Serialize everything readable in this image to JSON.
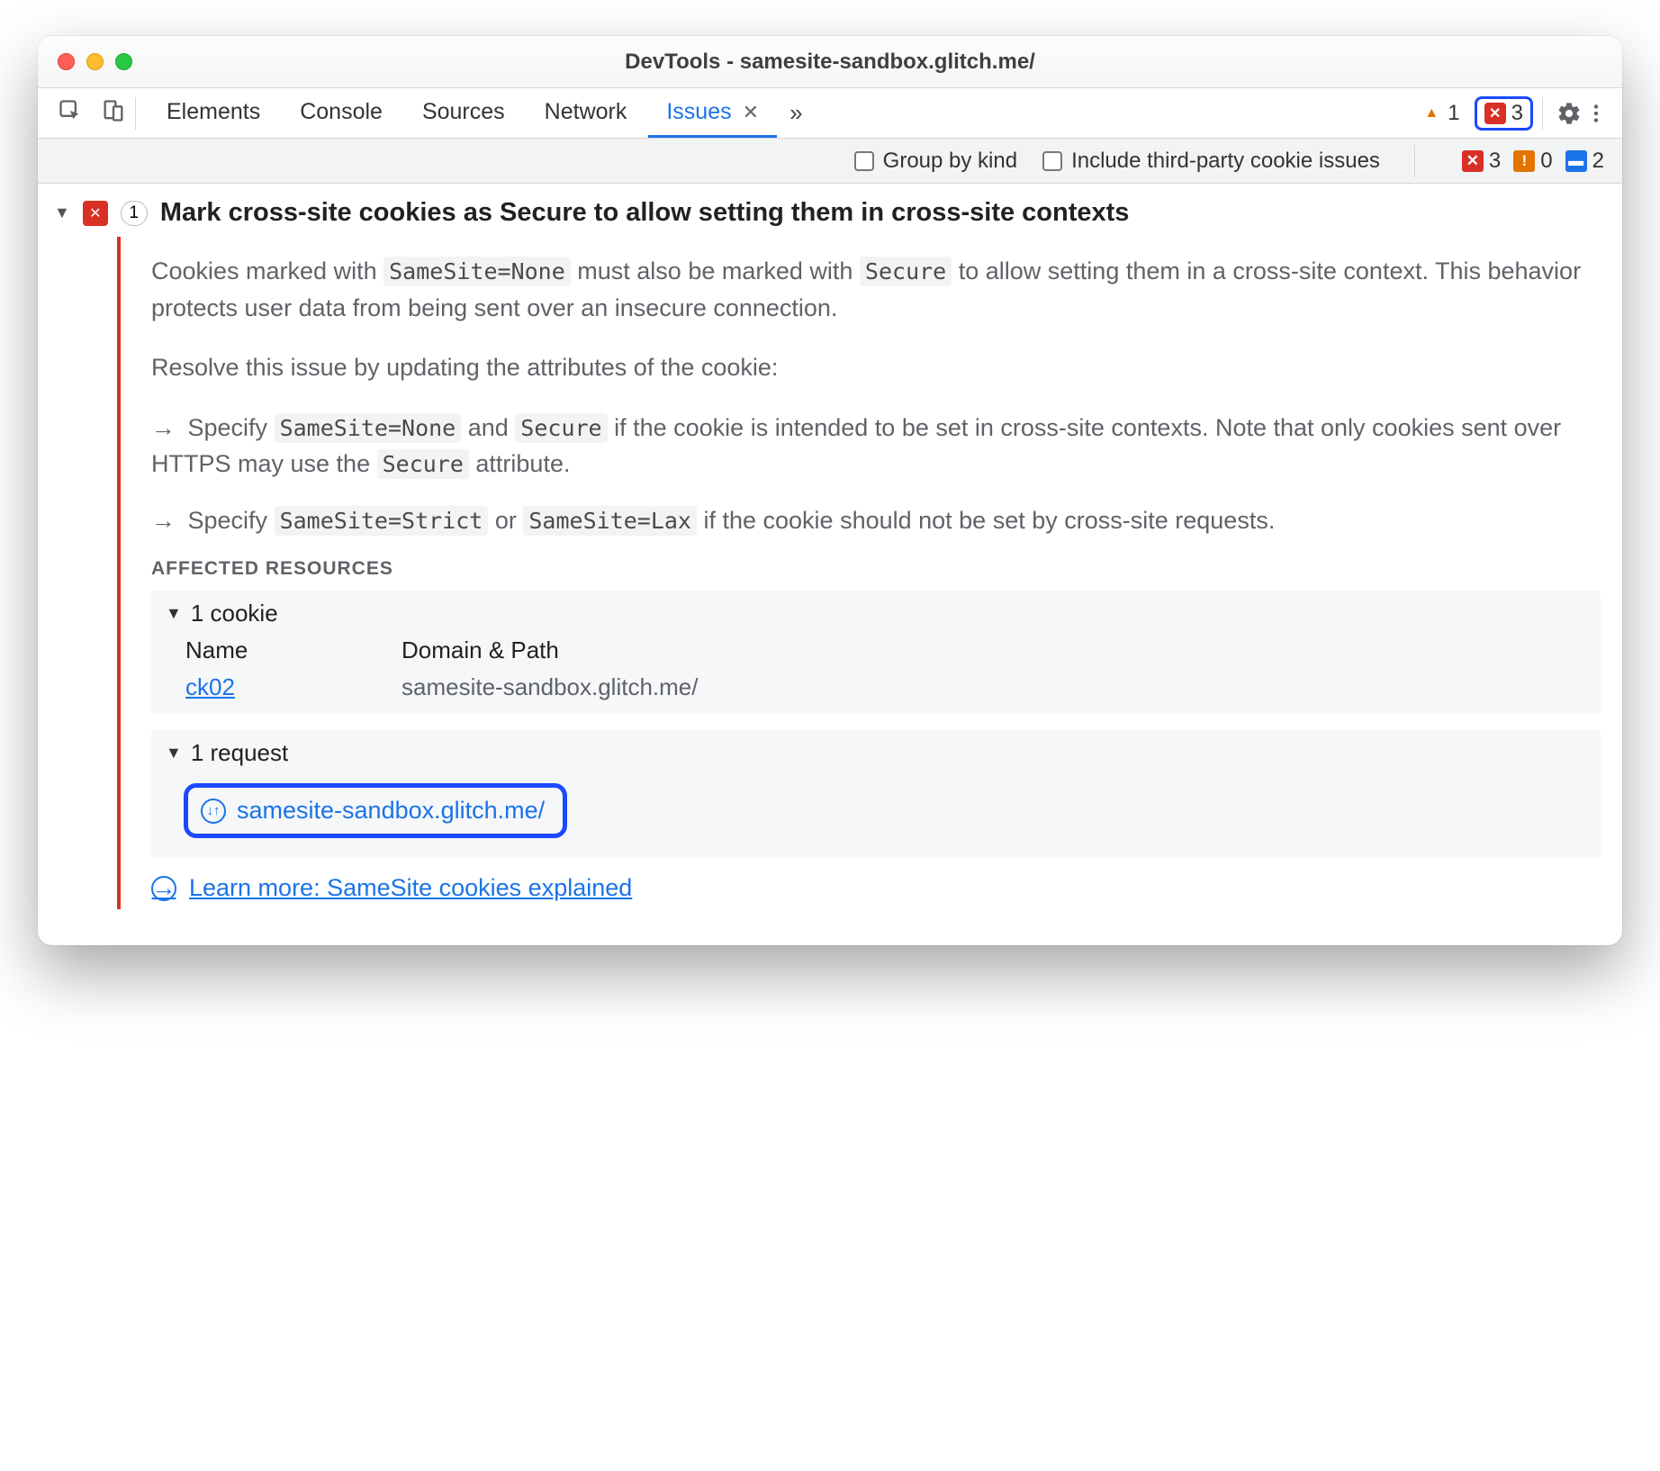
{
  "window": {
    "title": "DevTools - samesite-sandbox.glitch.me/"
  },
  "tabs": {
    "items": [
      "Elements",
      "Console",
      "Sources",
      "Network",
      "Issues"
    ],
    "active": "Issues",
    "more": "»"
  },
  "toolbarCounters": {
    "warn": "1",
    "err": "3"
  },
  "options": {
    "groupByKind": "Group by kind",
    "thirdParty": "Include third-party cookie issues",
    "status": {
      "err": "3",
      "warn": "0",
      "info": "2"
    }
  },
  "issue": {
    "count": "1",
    "title": "Mark cross-site cookies as Secure to allow setting them in cross-site contexts",
    "desc": {
      "p1a": "Cookies marked with ",
      "p1c1": "SameSite=None",
      "p1b": " must also be marked with ",
      "p1c2": "Secure",
      "p1c": " to allow setting them in a cross-site context. This behavior protects user data from being sent over an insecure connection.",
      "p2": "Resolve this issue by updating the attributes of the cookie:",
      "b1a": "Specify ",
      "b1c1": "SameSite=None",
      "b1b": " and ",
      "b1c2": "Secure",
      "b1c": " if the cookie is intended to be set in cross-site contexts. Note that only cookies sent over HTTPS may use the ",
      "b1c3": "Secure",
      "b1d": " attribute.",
      "b2a": "Specify ",
      "b2c1": "SameSite=Strict",
      "b2b": " or ",
      "b2c2": "SameSite=Lax",
      "b2c": " if the cookie should not be set by cross-site requests."
    },
    "affected": {
      "label": "AFFECTED RESOURCES",
      "cookieHeader": "1 cookie",
      "col1": "Name",
      "col2": "Domain & Path",
      "cookieName": "ck02",
      "cookieDomain": "samesite-sandbox.glitch.me/",
      "requestHeader": "1 request",
      "requestUrl": "samesite-sandbox.glitch.me/"
    },
    "learnMore": "Learn more: SameSite cookies explained"
  }
}
